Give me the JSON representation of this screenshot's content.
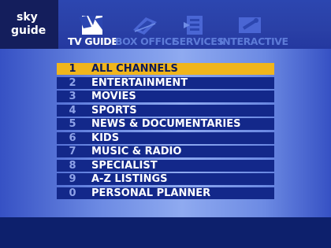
{
  "brand": {
    "line1": "sky",
    "line2": "guide"
  },
  "tabs": [
    {
      "label": "TV GUIDE",
      "icon": "tv-guide-icon",
      "active": true
    },
    {
      "label": "BOX OFFICE",
      "icon": "box-office-icon",
      "active": false
    },
    {
      "label": "SERVICES",
      "icon": "services-icon",
      "active": false
    },
    {
      "label": "INTERACTIVE",
      "icon": "interactive-icon",
      "active": false
    }
  ],
  "menu": {
    "selected_index": 0,
    "items": [
      {
        "number": "1",
        "label": "ALL CHANNELS"
      },
      {
        "number": "2",
        "label": "ENTERTAINMENT"
      },
      {
        "number": "3",
        "label": "MOVIES"
      },
      {
        "number": "4",
        "label": "SPORTS"
      },
      {
        "number": "5",
        "label": "NEWS & DOCUMENTARIES"
      },
      {
        "number": "6",
        "label": "KIDS"
      },
      {
        "number": "7",
        "label": "MUSIC & RADIO"
      },
      {
        "number": "8",
        "label": "SPECIALIST"
      },
      {
        "number": "9",
        "label": "A-Z LISTINGS"
      },
      {
        "number": "0",
        "label": "PERSONAL PLANNER"
      }
    ]
  },
  "colors": {
    "selected": "#f0b51c",
    "row": "#13288a",
    "header": "#2c46b0",
    "logo_bg": "#141e5c"
  }
}
